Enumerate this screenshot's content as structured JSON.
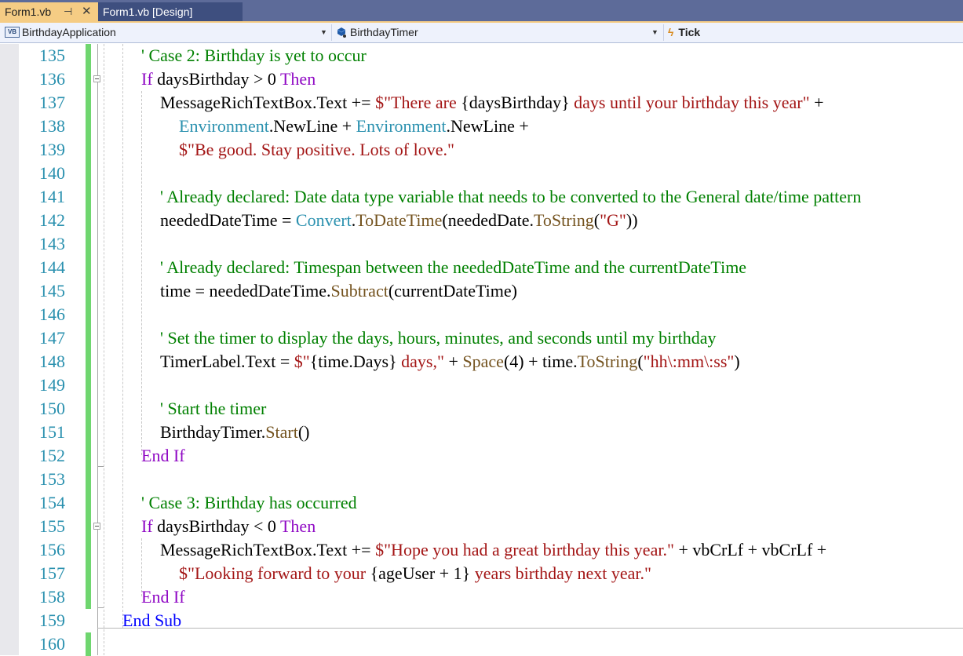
{
  "tabs": [
    {
      "label": "Form1.vb",
      "active": true,
      "pin_icon": "pin-icon",
      "close_icon": "close-icon"
    },
    {
      "label": "Form1.vb [Design]",
      "active": false
    }
  ],
  "navbar": {
    "project": {
      "icon": "vb-project-icon",
      "icon_text": "VB",
      "label": "BirthdayApplication"
    },
    "object": {
      "icon": "component-icon",
      "label": "BirthdayTimer"
    },
    "member": {
      "icon": "event-bolt-icon",
      "label": "Tick"
    }
  },
  "colors": {
    "keyword": "#8f08c4",
    "keyword_blue": "#0000ff",
    "comment": "#008000",
    "string": "#a31515",
    "type": "#2b91af",
    "method": "#74531f",
    "line_number": "#2b91af",
    "change_bar": "#6fd66f",
    "active_tab": "#f5cc84"
  },
  "code": {
    "lines": [
      {
        "num": "135",
        "tokens": [
          {
            "t": "' Case 2: Birthday is yet to occur",
            "c": "cm"
          }
        ]
      },
      {
        "num": "136",
        "tokens": [
          {
            "t": "If",
            "c": "kw"
          },
          {
            "t": " daysBirthday > 0 ",
            "c": ""
          },
          {
            "t": "Then",
            "c": "kw"
          }
        ]
      },
      {
        "num": "137",
        "tokens": [
          {
            "t": "MessageRichTextBox.Text += ",
            "c": ""
          },
          {
            "t": "$\"There are ",
            "c": "st"
          },
          {
            "t": "{daysBirthday}",
            "c": ""
          },
          {
            "t": " days until your birthday this year\"",
            "c": "st"
          },
          {
            "t": " +",
            "c": ""
          }
        ]
      },
      {
        "num": "138",
        "tokens": [
          {
            "t": "Environment",
            "c": "ty"
          },
          {
            "t": ".NewLine + ",
            "c": ""
          },
          {
            "t": "Environment",
            "c": "ty"
          },
          {
            "t": ".NewLine +",
            "c": ""
          }
        ]
      },
      {
        "num": "139",
        "tokens": [
          {
            "t": "$\"Be good. Stay positive. Lots of love.\"",
            "c": "st"
          }
        ]
      },
      {
        "num": "140",
        "tokens": []
      },
      {
        "num": "141",
        "tokens": [
          {
            "t": "' Already declared: Date data type variable that needs to be converted to the General date/time pattern",
            "c": "cm"
          }
        ]
      },
      {
        "num": "142",
        "tokens": [
          {
            "t": "neededDateTime = ",
            "c": ""
          },
          {
            "t": "Convert",
            "c": "ty"
          },
          {
            "t": ".",
            "c": ""
          },
          {
            "t": "ToDateTime",
            "c": "mt"
          },
          {
            "t": "(neededDate.",
            "c": ""
          },
          {
            "t": "ToString",
            "c": "mt"
          },
          {
            "t": "(",
            "c": ""
          },
          {
            "t": "\"G\"",
            "c": "st"
          },
          {
            "t": "))",
            "c": ""
          }
        ]
      },
      {
        "num": "143",
        "tokens": []
      },
      {
        "num": "144",
        "tokens": [
          {
            "t": "' Already declared: Timespan between the neededDateTime and the currentDateTime",
            "c": "cm"
          }
        ]
      },
      {
        "num": "145",
        "tokens": [
          {
            "t": "time = neededDateTime.",
            "c": ""
          },
          {
            "t": "Subtract",
            "c": "mt"
          },
          {
            "t": "(currentDateTime)",
            "c": ""
          }
        ]
      },
      {
        "num": "146",
        "tokens": []
      },
      {
        "num": "147",
        "tokens": [
          {
            "t": "' Set the timer to display the days, hours, minutes, and seconds until my birthday",
            "c": "cm"
          }
        ]
      },
      {
        "num": "148",
        "tokens": [
          {
            "t": "TimerLabel.Text = ",
            "c": ""
          },
          {
            "t": "$\"",
            "c": "st"
          },
          {
            "t": "{time.Days}",
            "c": ""
          },
          {
            "t": " days,\"",
            "c": "st"
          },
          {
            "t": " + ",
            "c": ""
          },
          {
            "t": "Space",
            "c": "mt"
          },
          {
            "t": "(4) + time.",
            "c": ""
          },
          {
            "t": "ToString",
            "c": "mt"
          },
          {
            "t": "(",
            "c": ""
          },
          {
            "t": "\"hh\\:mm\\:ss\"",
            "c": "st"
          },
          {
            "t": ")",
            "c": ""
          }
        ]
      },
      {
        "num": "149",
        "tokens": []
      },
      {
        "num": "150",
        "tokens": [
          {
            "t": "' Start the timer",
            "c": "cm"
          }
        ]
      },
      {
        "num": "151",
        "tokens": [
          {
            "t": "BirthdayTimer.",
            "c": ""
          },
          {
            "t": "Start",
            "c": "mt"
          },
          {
            "t": "()",
            "c": ""
          }
        ]
      },
      {
        "num": "152",
        "tokens": [
          {
            "t": "End If",
            "c": "kw"
          }
        ]
      },
      {
        "num": "153",
        "tokens": []
      },
      {
        "num": "154",
        "tokens": [
          {
            "t": "' Case 3: Birthday has occurred",
            "c": "cm"
          }
        ]
      },
      {
        "num": "155",
        "tokens": [
          {
            "t": "If",
            "c": "kw"
          },
          {
            "t": " daysBirthday < 0 ",
            "c": ""
          },
          {
            "t": "Then",
            "c": "kw"
          }
        ]
      },
      {
        "num": "156",
        "tokens": [
          {
            "t": "MessageRichTextBox.Text += ",
            "c": ""
          },
          {
            "t": "$\"Hope you had a great birthday this year.\"",
            "c": "st"
          },
          {
            "t": " + vbCrLf + vbCrLf +",
            "c": ""
          }
        ]
      },
      {
        "num": "157",
        "tokens": [
          {
            "t": "$\"Looking forward to your ",
            "c": "st"
          },
          {
            "t": "{ageUser + 1}",
            "c": ""
          },
          {
            "t": " years birthday next year.\"",
            "c": "st"
          }
        ]
      },
      {
        "num": "158",
        "tokens": [
          {
            "t": "End If",
            "c": "kw"
          }
        ]
      },
      {
        "num": "159",
        "tokens": [
          {
            "t": "End Sub",
            "c": "kwb"
          }
        ]
      },
      {
        "num": "160",
        "tokens": []
      }
    ]
  }
}
